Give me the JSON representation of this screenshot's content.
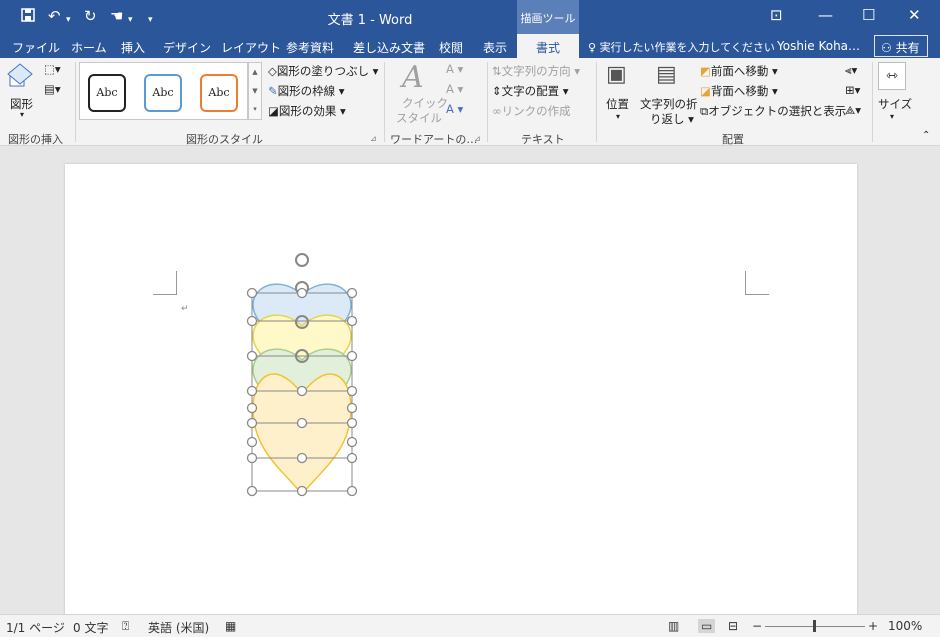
{
  "window": {
    "title": "文書 1 - Word",
    "context_tab_group": "描画ツール"
  },
  "tabs": [
    "ファイル",
    "ホーム",
    "挿入",
    "デザイン",
    "レイアウト",
    "参考資料",
    "差し込み文書",
    "校閲",
    "表示",
    "書式"
  ],
  "active_tab": "書式",
  "tell_me": "実行したい作業を入力してください",
  "user": "Yoshie Koha…",
  "share": "共有",
  "ribbon": {
    "insert_shapes": {
      "shape_label": "図形",
      "group_label": "図形の挿入"
    },
    "shape_styles": {
      "gallery": [
        "Abc",
        "Abc",
        "Abc"
      ],
      "fill": "図形の塗りつぶし",
      "outline": "図形の枠線",
      "effects": "図形の効果",
      "group_label": "図形のスタイル"
    },
    "wordart": {
      "quick_style_1": "クイック",
      "quick_style_2": "スタイル",
      "group_label": "ワードアートの…"
    },
    "text": {
      "direction": "文字列の方向",
      "align": "文字の配置",
      "link": "リンクの作成",
      "group_label": "テキスト"
    },
    "arrange": {
      "position": "位置",
      "wrap_1": "文字列の折",
      "wrap_2": "り返し",
      "bring_forward": "前面へ移動",
      "send_backward": "背面へ移動",
      "selection_pane": "オブジェクトの選択と表示",
      "group_label": "配置"
    },
    "size": {
      "label": "サイズ"
    }
  },
  "status": {
    "page": "1/1 ページ",
    "words": "0 文字",
    "language": "英語 (米国)",
    "zoom": "100%"
  },
  "colors": {
    "title_bar": "#2b579a",
    "ribbon": "#f3f3f3",
    "heart_blue": "#dceaf7",
    "heart_yellow": "#fff8c8",
    "heart_green": "#e2efda",
    "heart_orange": "#fff0cc"
  }
}
